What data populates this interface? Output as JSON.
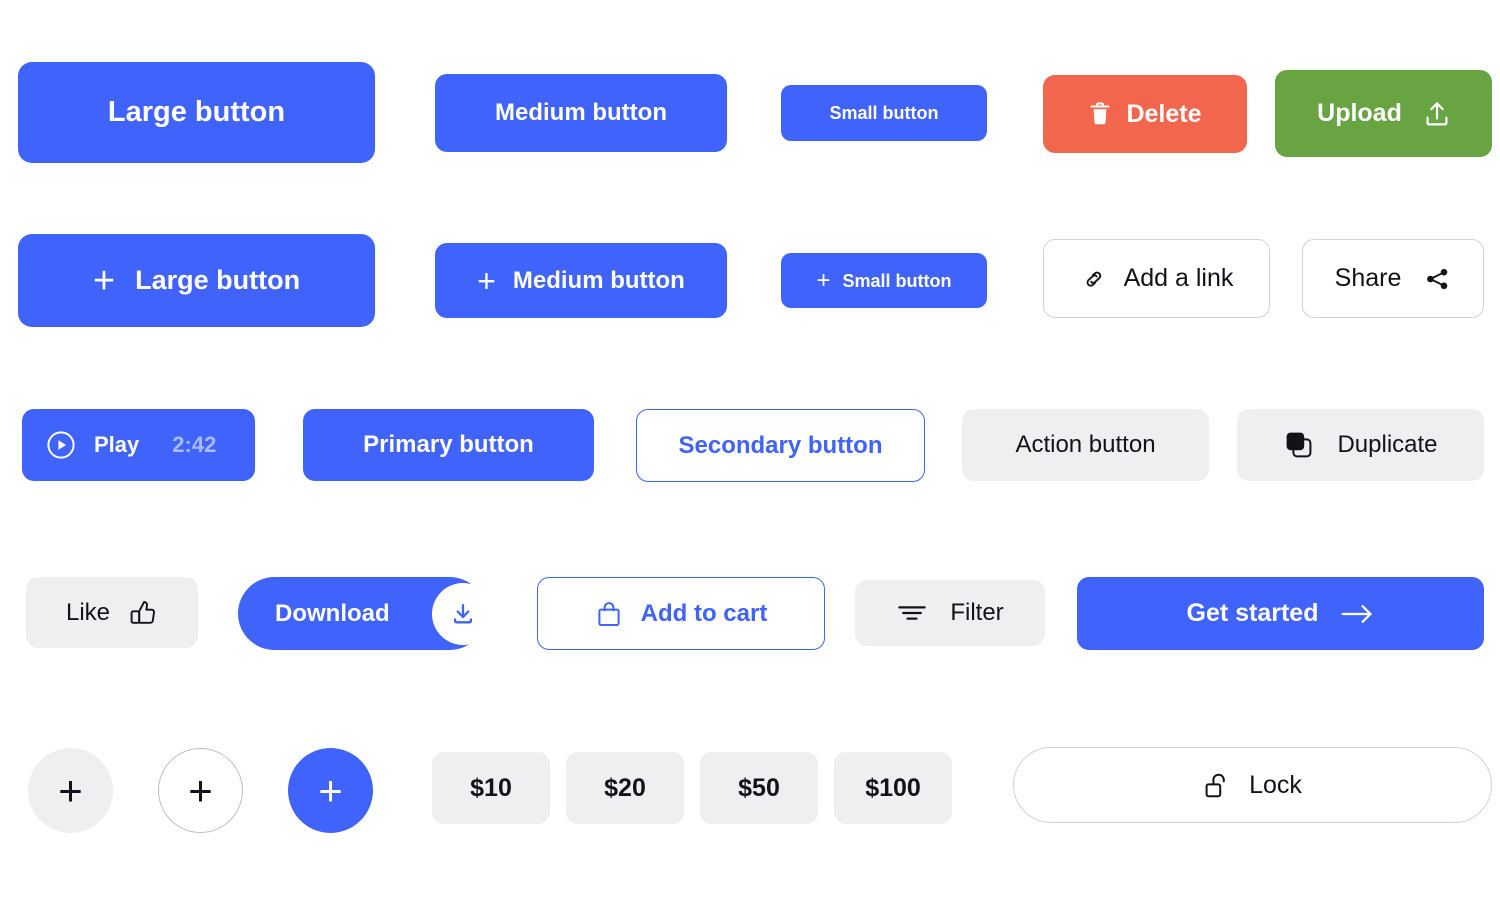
{
  "palette": {
    "primary_blue": "#3f63fb",
    "danger_red": "#f1664c",
    "success_green": "#68a442",
    "neutral_grey": "#efeff1",
    "text_dark": "#12121a",
    "muted_blue": "#a8bbfd",
    "border_grey": "#cfd3da"
  },
  "rows": {
    "sizes": {
      "large": "Large button",
      "medium": "Medium button",
      "small": "Small button",
      "delete": "Delete",
      "upload": "Upload"
    },
    "with_add": {
      "large": "Large button",
      "medium": "Medium button",
      "small": "Small button",
      "add_link": "Add a link",
      "share": "Share"
    },
    "variants": {
      "play": "Play",
      "play_time": "2:42",
      "primary": "Primary button",
      "secondary": "Secondary button",
      "action": "Action button",
      "duplicate": "Duplicate"
    },
    "actions": {
      "like": "Like",
      "download": "Download",
      "add_to_cart": "Add to cart",
      "filter": "Filter",
      "get_started": "Get started"
    },
    "compact": {
      "plus": "+",
      "price_10": "$10",
      "price_20": "$20",
      "price_50": "$50",
      "price_100": "$100",
      "lock": "Lock"
    }
  },
  "icons": {
    "trash": "trash-icon",
    "upload": "upload-icon",
    "plus": "plus-icon",
    "link": "link-icon",
    "share": "share-icon",
    "play": "play-circle-icon",
    "duplicate": "duplicate-icon",
    "thumbs_up": "thumbs-up-icon",
    "download": "download-icon",
    "shopping_bag": "shopping-bag-icon",
    "filter": "filter-icon",
    "arrow_right": "arrow-right-icon",
    "lock_open": "lock-open-icon"
  }
}
